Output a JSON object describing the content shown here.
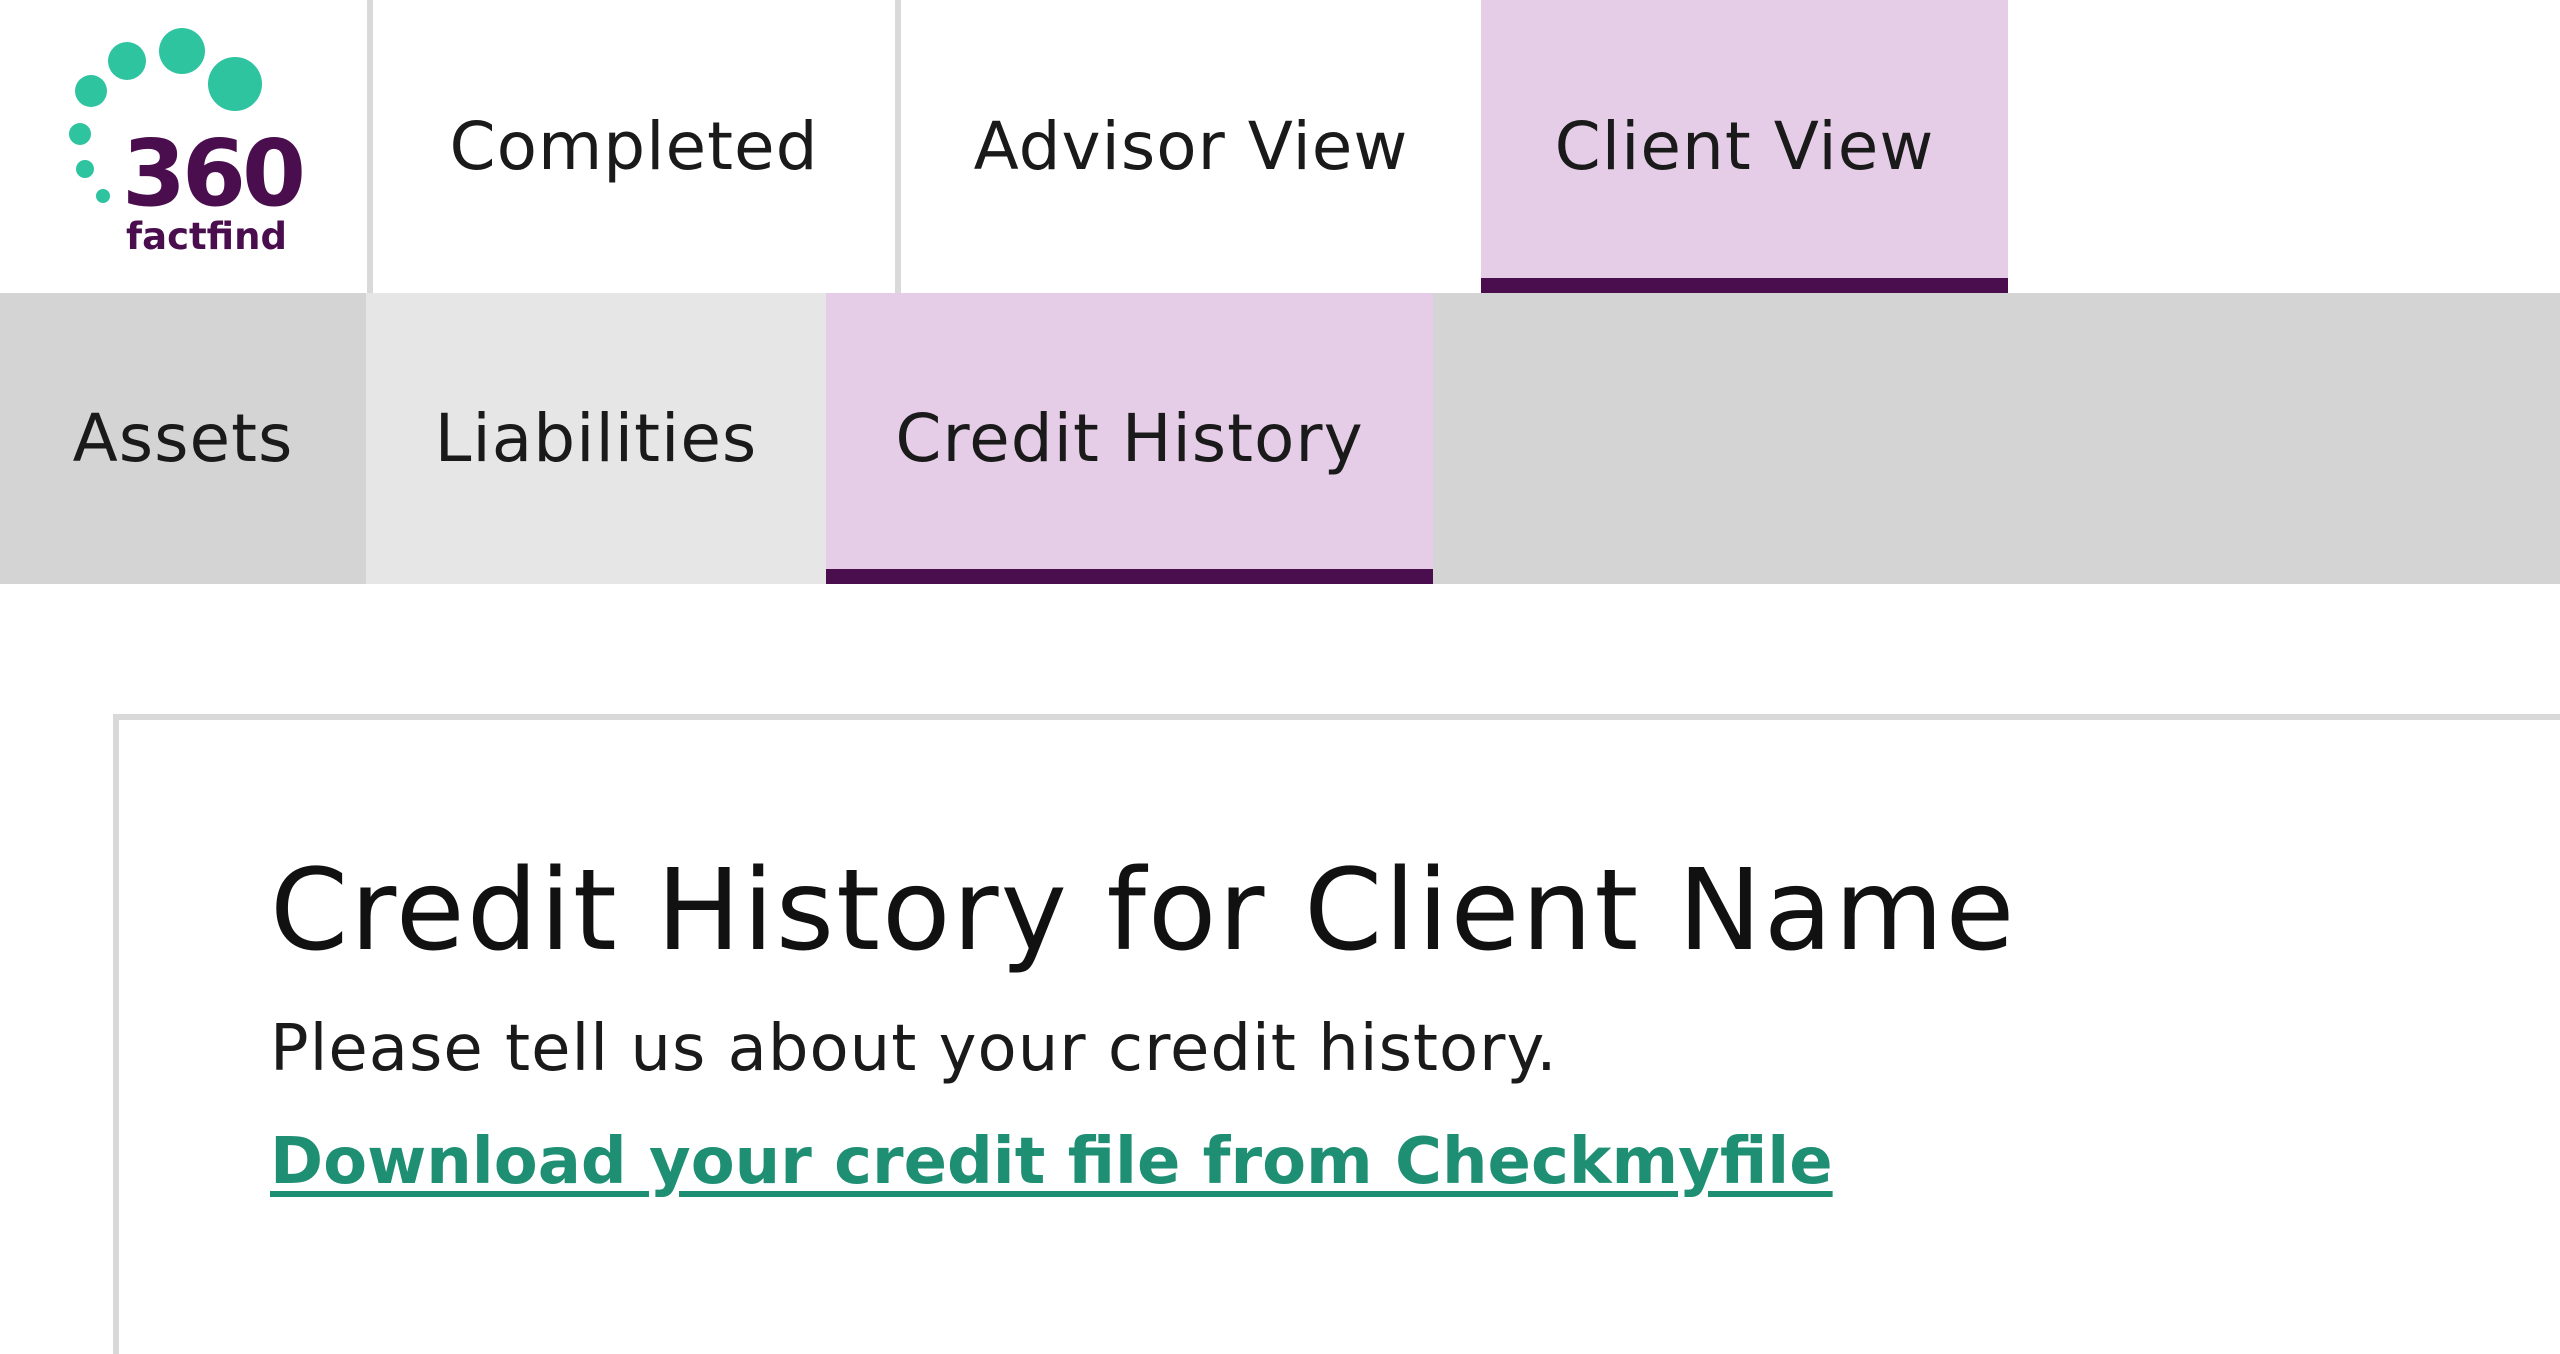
{
  "logo": {
    "number": "360",
    "word": "factfind",
    "number_color": "#4a0e4e",
    "dots_color": "#2ec4a0"
  },
  "top_nav": {
    "tabs": [
      {
        "label": "Completed",
        "active": false
      },
      {
        "label": "Advisor View",
        "active": false
      },
      {
        "label": "Client View",
        "active": true
      }
    ]
  },
  "sub_nav": {
    "tabs": [
      {
        "label": "Assets",
        "active": false
      },
      {
        "label": "Liabilities",
        "active": false
      },
      {
        "label": "Credit History",
        "active": true
      }
    ]
  },
  "content": {
    "title": "Credit History for Client Name",
    "description": "Please tell us about your credit history.",
    "link_text": "Download your credit file from Checkmyfile"
  },
  "colors": {
    "active_tab_bg": "#e6cde7",
    "active_tab_underline": "#4a0e4e",
    "link": "#1e8f73",
    "subbar_bg": "#d4d4d4"
  }
}
